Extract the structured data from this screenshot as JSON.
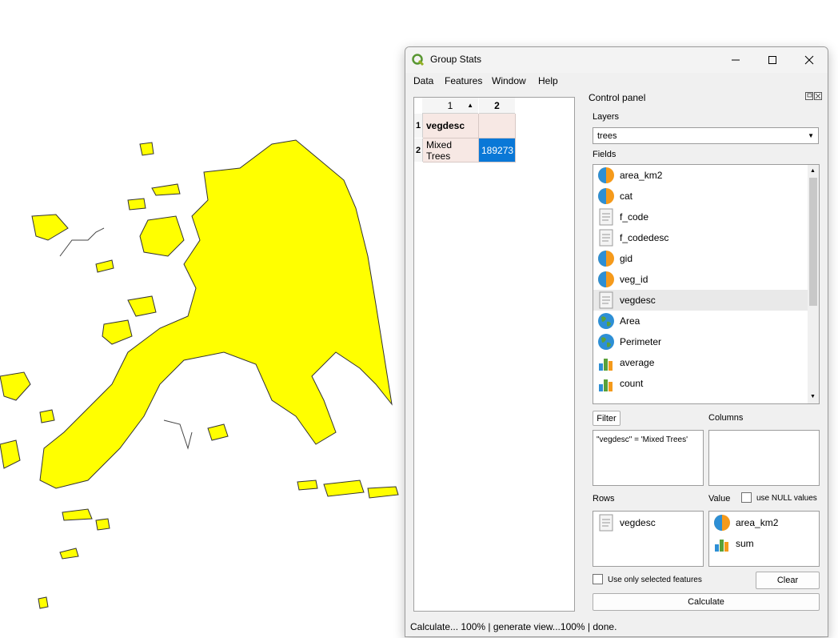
{
  "window": {
    "title": "Group Stats"
  },
  "menu": [
    "Data",
    "Features",
    "Window",
    "Help"
  ],
  "table": {
    "col_headers": [
      "1",
      "2"
    ],
    "row_headers": [
      "1",
      "2"
    ],
    "rows": [
      [
        "vegdesc",
        ""
      ],
      [
        "Mixed Trees",
        "189273"
      ]
    ]
  },
  "control_panel": {
    "title": "Control panel",
    "layers_label": "Layers",
    "layer_value": "trees",
    "fields_label": "Fields",
    "fields": [
      {
        "name": "area_km2",
        "icon": "number-field-icon"
      },
      {
        "name": "cat",
        "icon": "number-field-icon"
      },
      {
        "name": "f_code",
        "icon": "text-field-icon"
      },
      {
        "name": "f_codedesc",
        "icon": "text-field-icon"
      },
      {
        "name": "gid",
        "icon": "number-field-icon"
      },
      {
        "name": "veg_id",
        "icon": "number-field-icon"
      },
      {
        "name": "vegdesc",
        "icon": "text-field-icon"
      },
      {
        "name": "Area",
        "icon": "globe-icon"
      },
      {
        "name": "Perimeter",
        "icon": "globe-icon"
      },
      {
        "name": "average",
        "icon": "stats-icon"
      },
      {
        "name": "count",
        "icon": "stats-icon"
      }
    ],
    "filter_button": "Filter",
    "columns_label": "Columns",
    "filter_expression": "\"vegdesc\" = 'Mixed Trees'",
    "rows_label": "Rows",
    "value_label": "Value",
    "use_null_label": "use NULL values",
    "rows_items": [
      "vegdesc"
    ],
    "value_items": [
      "area_km2",
      "sum"
    ],
    "use_selected_label": "Use only selected features",
    "clear_button": "Clear",
    "calculate_button": "Calculate"
  },
  "status": "Calculate... 100% |  generate view...100% |  done.",
  "colors": {
    "selection": "#0a78d7",
    "polygon_fill": "#ffff00",
    "cell_bg": "#f7e8e4"
  }
}
